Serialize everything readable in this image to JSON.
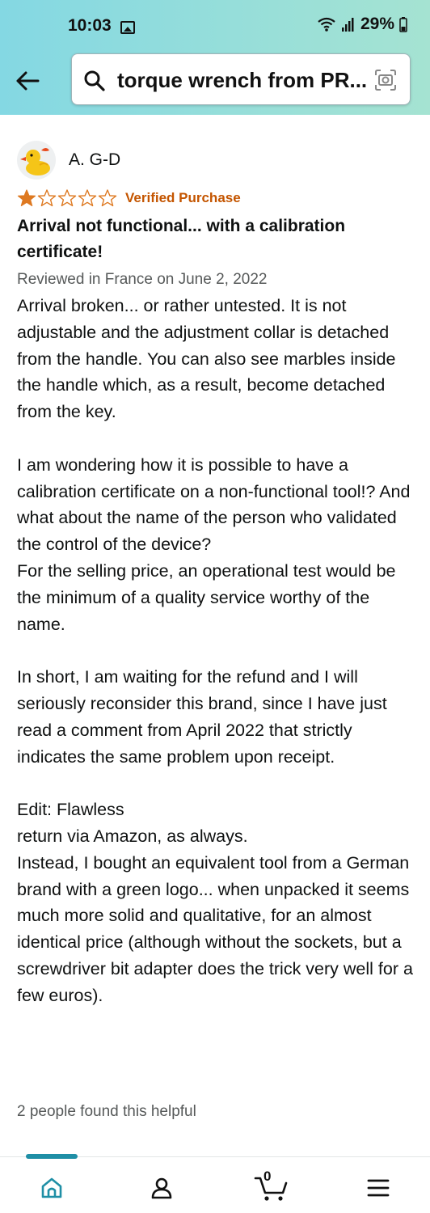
{
  "status_bar": {
    "time": "10:03",
    "battery": "29%"
  },
  "search": {
    "query": "torque wrench from PR..."
  },
  "review": {
    "author": "A. G-D",
    "rating": 1,
    "rating_max": 5,
    "verified": "Verified Purchase",
    "title": "Arrival not functional... with a calibration certificate!",
    "meta": "Reviewed in France on June 2, 2022",
    "paragraphs": [
      "Arrival broken... or rather untested. It is not adjustable and the adjustment collar is detached from the handle. You can also see marbles inside the handle which, as a result, become detached from the key.",
      "I am wondering how it is possible to have a calibration certificate on a non-functional tool!? And what about the name of the person who validated the control of the device?",
      "For the selling price, an operational test would be the minimum of a quality service worthy of the name.",
      "In short, I am waiting for the refund and I will seriously reconsider this brand, since I have just read a comment from April 2022 that strictly indicates the same problem upon receipt.",
      "Edit: Flawless",
      "return via Amazon, as always.",
      "Instead, I bought an equivalent tool from a German brand with a green logo... when unpacked it seems much more solid and qualitative, for an almost identical price (although without the sockets, but a screwdriver bit adapter does the trick very well for a few euros)."
    ],
    "helpful": "2 people found this helpful"
  },
  "nav": {
    "cart_count": "0"
  },
  "colors": {
    "accent": "#1f8fa6",
    "star": "#de7921",
    "verified": "#c45500"
  }
}
